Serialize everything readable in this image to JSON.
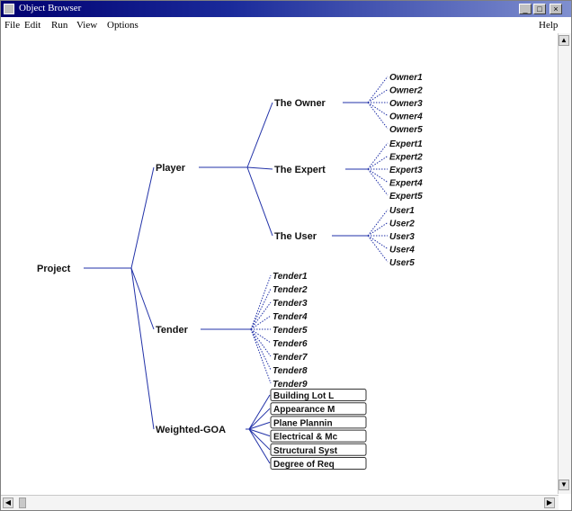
{
  "window": {
    "title": "Object Browser",
    "controls": [
      "_",
      "□",
      "×"
    ]
  },
  "menu": {
    "left": [
      "File",
      "Edit",
      "Run",
      "View",
      "Options"
    ],
    "right": "Help"
  },
  "tree": {
    "root": "Project",
    "player": {
      "label": "Player",
      "groups": [
        {
          "label": "The Owner",
          "leaves": [
            "Owner1",
            "Owner2",
            "Owner3",
            "Owner4",
            "Owner5"
          ]
        },
        {
          "label": "The Expert",
          "leaves": [
            "Expert1",
            "Expert2",
            "Expert3",
            "Expert4",
            "Expert5"
          ]
        },
        {
          "label": "The User",
          "leaves": [
            "User1",
            "User2",
            "User3",
            "User4",
            "User5"
          ]
        }
      ]
    },
    "tender": {
      "label": "Tender",
      "leaves": [
        "Tender1",
        "Tender2",
        "Tender3",
        "Tender4",
        "Tender5",
        "Tender6",
        "Tender7",
        "Tender8",
        "Tender9"
      ]
    },
    "weighted": {
      "label": "Weighted-GOA",
      "boxes": [
        "Building Lot L",
        "Appearance M",
        "Plane Plannin",
        "Electrical & Mc",
        "Structural Syst",
        "Degree of Req"
      ]
    }
  }
}
